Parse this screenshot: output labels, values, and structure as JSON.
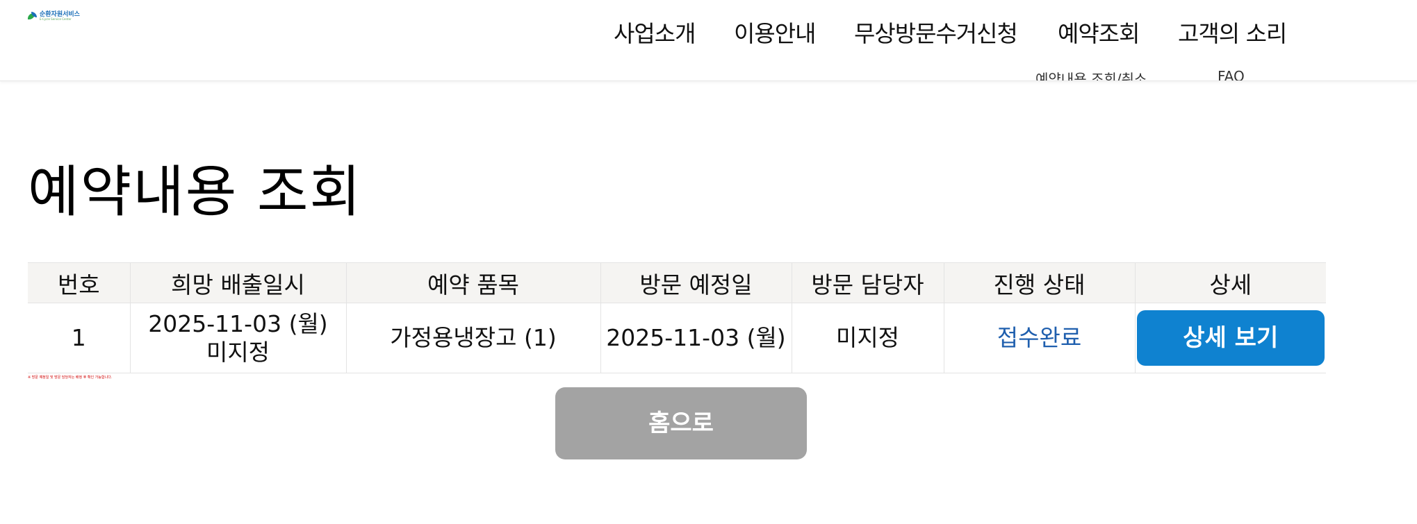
{
  "header": {
    "logo_name": "순환자원서비스",
    "logo_sub": "E-Cycle Service Center",
    "nav": [
      {
        "label": "사업소개"
      },
      {
        "label": "이용안내"
      },
      {
        "label": "무상방문수거신청"
      },
      {
        "label": "예약조회"
      },
      {
        "label": "고객의 소리"
      }
    ],
    "subnav": [
      {
        "label": "예약내용 조회/취소"
      },
      {
        "label": "FAQ"
      }
    ]
  },
  "page": {
    "title": "예약내용 조회"
  },
  "table": {
    "headers": [
      "번호",
      "희망 배출일시",
      "예약 품목",
      "방문 예정일",
      "방문 담당자",
      "진행 상태",
      "상세"
    ],
    "rows": [
      {
        "number": "1",
        "preferred_date": "2025-11-03 (월)",
        "preferred_time": "미지정",
        "item": "가정용냉장고 (1)",
        "visit_date": "2025-11-03 (월)",
        "staff": "미지정",
        "status": "접수완료",
        "detail_label": "상세 보기"
      }
    ]
  },
  "note": "※ 방문 예정일 및 방문 담당자는 배정 후 확인 가능합니다.",
  "home_button": "홈으로",
  "colors": {
    "detail_button": "#0f82d0",
    "status_text": "#1f5fae",
    "home_button": "#a3a3a3",
    "table_header_bg": "#f5f4f2"
  }
}
